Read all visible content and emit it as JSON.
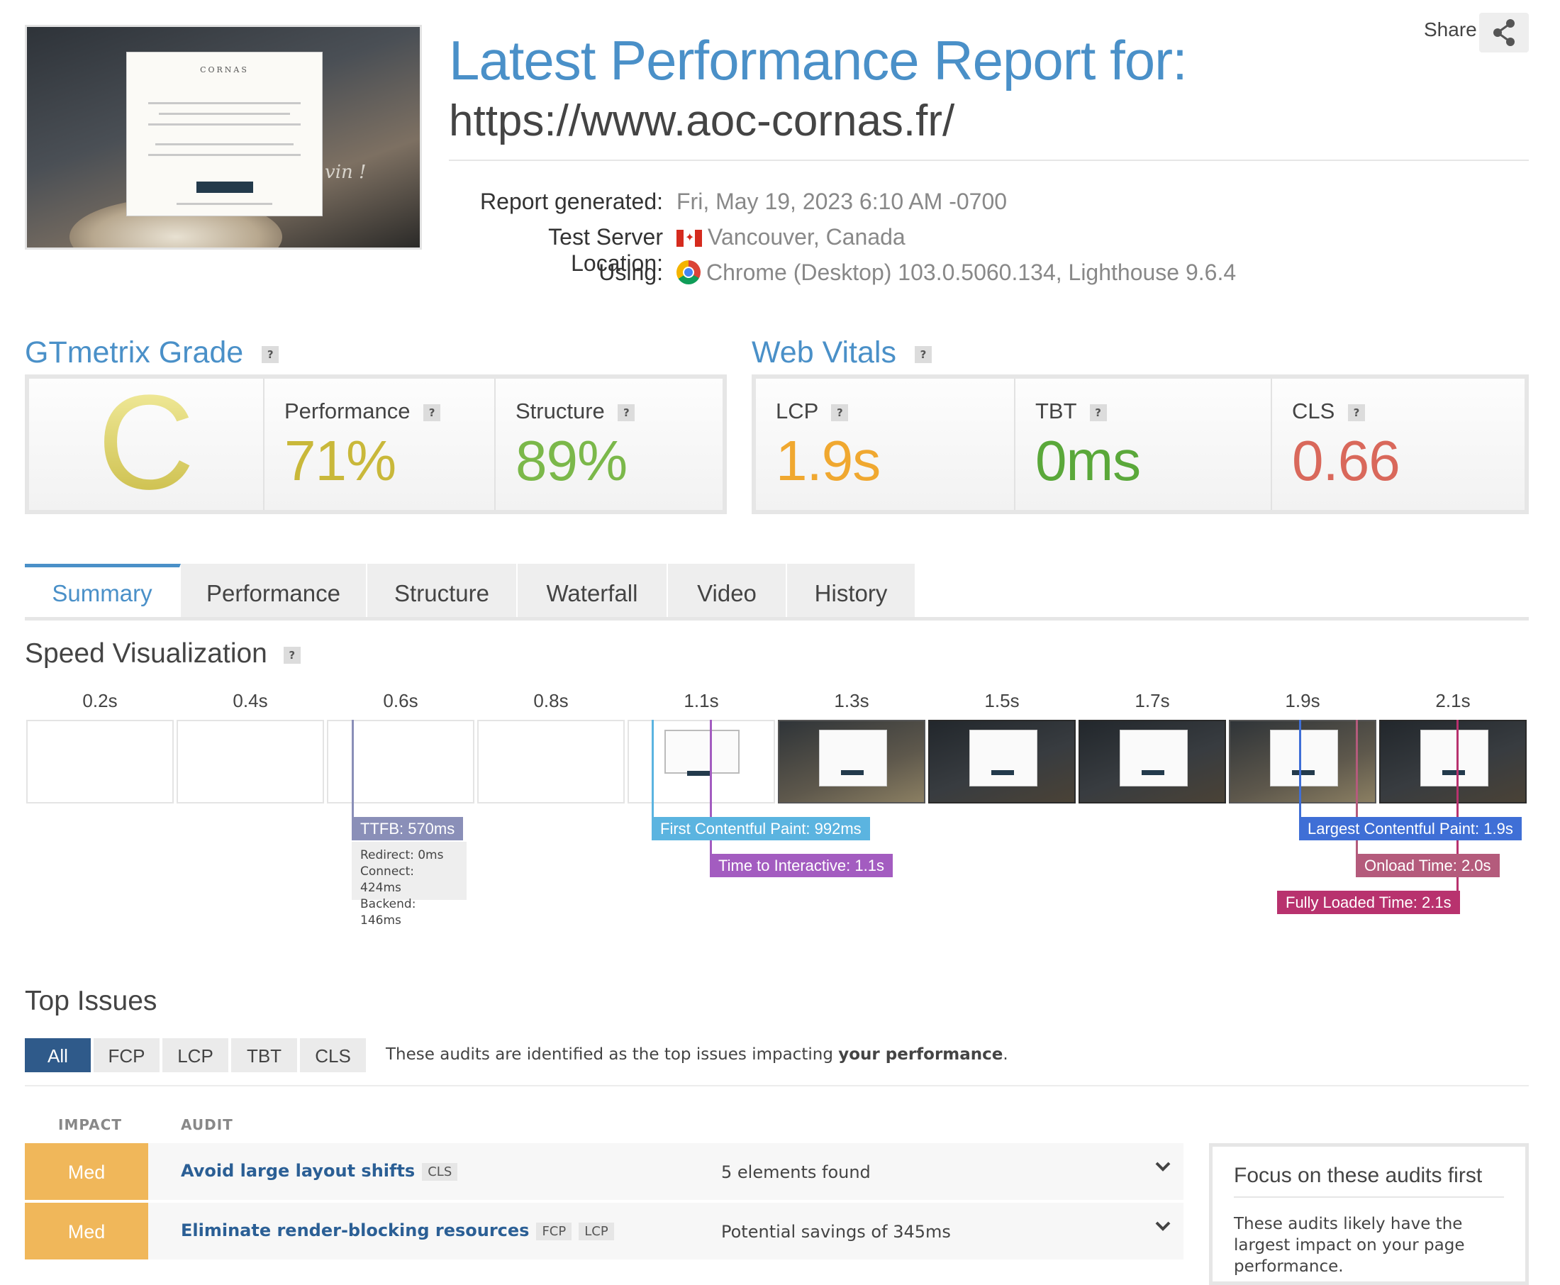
{
  "header": {
    "title": "Latest Performance Report for:",
    "url": "https://www.aoc-cornas.fr/",
    "share_label": "Share",
    "thumbnail": {
      "logo_text": "CORNAS",
      "overlay_text": "vin !"
    }
  },
  "meta": {
    "report_generated_label": "Report generated:",
    "report_generated_value": "Fri, May 19, 2023 6:10 AM -0700",
    "location_label": "Test Server Location:",
    "location_value": "Vancouver, Canada",
    "using_label": "Using:",
    "using_value": "Chrome (Desktop) 103.0.5060.134, Lighthouse 9.6.4"
  },
  "grade": {
    "title": "GTmetrix Grade",
    "help": "?",
    "letter": "C",
    "performance_label": "Performance",
    "performance_value": "71%",
    "structure_label": "Structure",
    "structure_value": "89%"
  },
  "vitals": {
    "title": "Web Vitals",
    "help": "?",
    "lcp_label": "LCP",
    "lcp_value": "1.9s",
    "tbt_label": "TBT",
    "tbt_value": "0ms",
    "cls_label": "CLS",
    "cls_value": "0.66"
  },
  "colors": {
    "accent": "#4a90c8",
    "grade_c": "#d6d068",
    "performance": "#c9b83a",
    "structure": "#7bb84a",
    "lcp": "#f0a830",
    "tbt": "#5aa83a",
    "cls": "#d9685b"
  },
  "tabs": [
    {
      "label": "Summary",
      "active": true
    },
    {
      "label": "Performance"
    },
    {
      "label": "Structure"
    },
    {
      "label": "Waterfall"
    },
    {
      "label": "Video"
    },
    {
      "label": "History"
    }
  ],
  "speed": {
    "title": "Speed Visualization",
    "help": "?",
    "timeline": [
      "0.2s",
      "0.4s",
      "0.6s",
      "0.8s",
      "1.1s",
      "1.3s",
      "1.5s",
      "1.7s",
      "1.9s",
      "2.1s"
    ],
    "markers": {
      "ttfb": "TTFB: 570ms",
      "ttfb_redirect": "Redirect: 0ms",
      "ttfb_connect": "Connect: 424ms",
      "ttfb_backend": "Backend: 146ms",
      "fcp": "First Contentful Paint: 992ms",
      "tti": "Time to Interactive: 1.1s",
      "lcp": "Largest Contentful Paint: 1.9s",
      "onload": "Onload Time: 2.0s",
      "fully_loaded": "Fully Loaded Time: 2.1s"
    }
  },
  "issues": {
    "title": "Top Issues",
    "filters": [
      "All",
      "FCP",
      "LCP",
      "TBT",
      "CLS"
    ],
    "description_prefix": "These audits are identified as the top issues impacting ",
    "description_bold": "your performance",
    "description_suffix": ".",
    "col_impact": "IMPACT",
    "col_audit": "AUDIT",
    "rows": [
      {
        "impact": "Med",
        "audit": "Avoid large layout shifts",
        "tags": [
          "CLS"
        ],
        "result": "5 elements found"
      },
      {
        "impact": "Med",
        "audit": "Eliminate render-blocking resources",
        "tags": [
          "FCP",
          "LCP"
        ],
        "result": "Potential savings of 345ms"
      }
    ],
    "focus_title": "Focus on these audits first",
    "focus_text": "These audits likely have the largest impact on your page performance."
  }
}
